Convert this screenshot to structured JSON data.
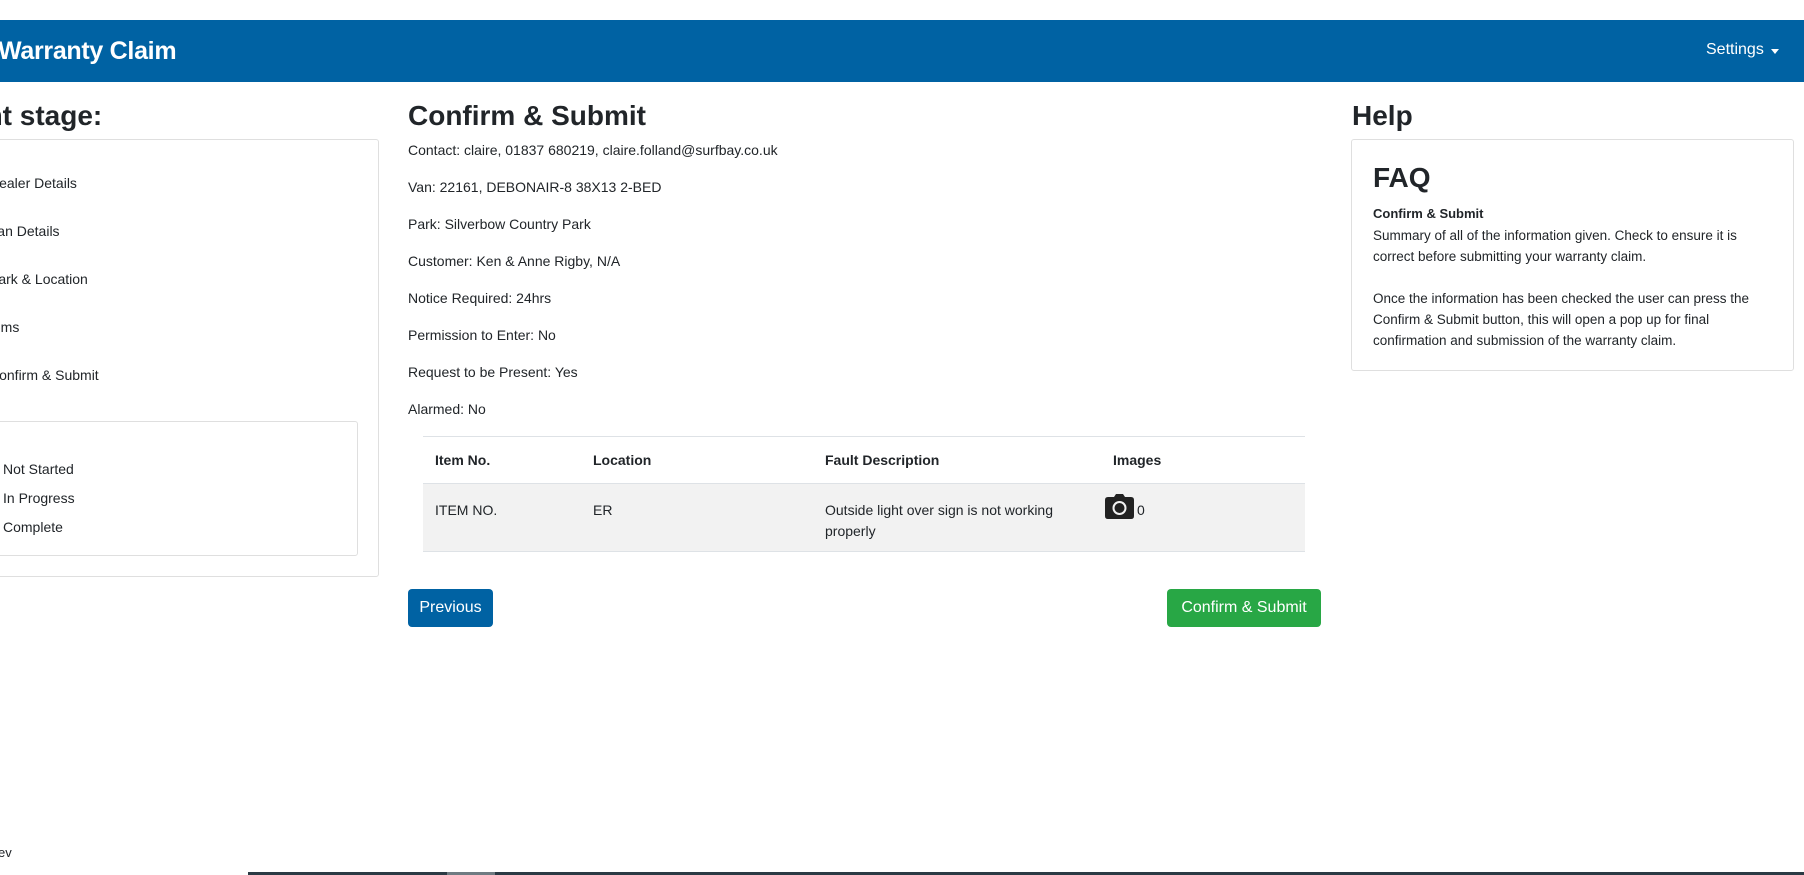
{
  "header": {
    "brand": "Warranty Claim",
    "settings_label": "Settings"
  },
  "stages": {
    "title": "ent stage:",
    "items": [
      {
        "label": "Dealer Details"
      },
      {
        "label": "Van Details"
      },
      {
        "label": "Park & Location"
      },
      {
        "label": "tems"
      },
      {
        "label": "Confirm & Submit"
      }
    ],
    "key": {
      "title": "/:",
      "entries": [
        {
          "label": "Not Started",
          "color": "#ff0000"
        },
        {
          "label": "In Progress",
          "color": "#ffa500"
        },
        {
          "label": "Complete",
          "color": "#008000"
        }
      ]
    }
  },
  "main": {
    "title": "Confirm & Submit",
    "info": [
      "Contact: claire, 01837 680219, claire.folland@surfbay.co.uk",
      "Van: 22161, DEBONAIR-8 38X13 2-BED",
      "Park: Silverbow Country Park",
      "Customer: Ken & Anne Rigby, N/A",
      "Notice Required: 24hrs",
      "Permission to Enter: No",
      "Request to be Present: Yes",
      "Alarmed: No"
    ],
    "table": {
      "headers": [
        "Item No.",
        "Location",
        "Fault Description",
        "Images"
      ],
      "rows": [
        {
          "item_no": "ITEM NO.",
          "location": "ER",
          "fault": "Outside light over sign is not working properly",
          "image_count": "0",
          "image_icon": "camera-icon"
        }
      ]
    },
    "previous_label": "Previous",
    "confirm_label": "Confirm & Submit"
  },
  "help": {
    "title": "Help",
    "faq_title": "FAQ",
    "faq_subtitle": "Confirm & Submit",
    "paragraph1": "Summary of all of the information given. Check to ensure it is correct before submitting your warranty claim.",
    "paragraph2": "Once the information has been checked the user can press the Confirm & Submit button, this will open a pop up for final confirmation and submission of the warranty claim."
  },
  "footer": {
    "text": "ev"
  },
  "colors": {
    "navbar": "#0062a3",
    "primary_button": "#0062a3",
    "success_button": "#28a745"
  }
}
